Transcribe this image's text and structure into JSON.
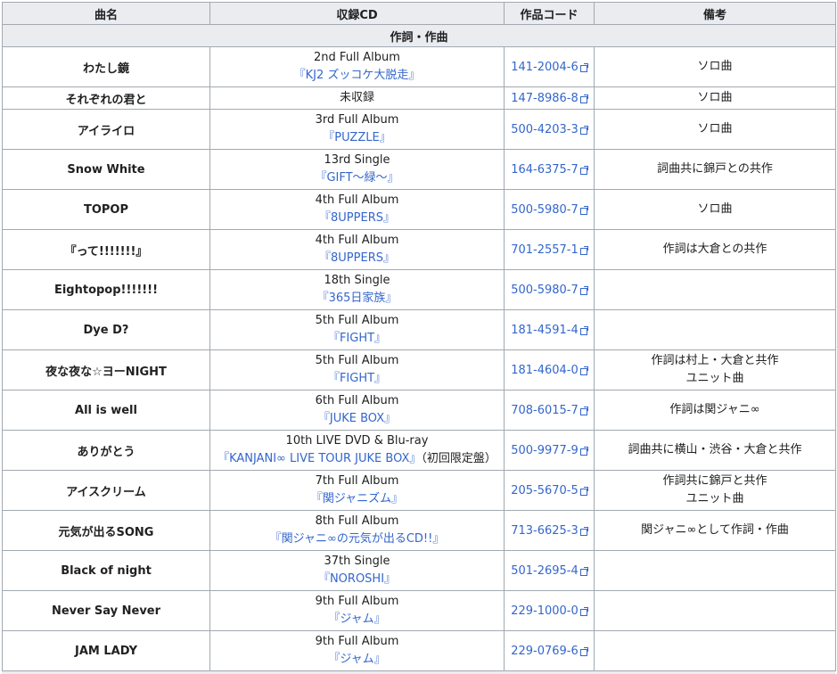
{
  "headers": {
    "song": "曲名",
    "cd": "収録CD",
    "code": "作品コード",
    "notes": "備考"
  },
  "section": "作詞・作曲",
  "rows": [
    {
      "title": "わたし鏡",
      "release": "2nd Full Album",
      "album": "『KJ2 ズッコケ大脱走』",
      "album_extra": "",
      "code": "141-2004-6",
      "notes": [
        "ソロ曲"
      ]
    },
    {
      "title": "それぞれの君と",
      "release": "未収録",
      "album": "",
      "album_extra": "",
      "code": "147-8986-8",
      "notes": [
        "ソロ曲"
      ]
    },
    {
      "title": "アイライロ",
      "release": "3rd Full Album",
      "album": "『PUZZLE』",
      "album_extra": "",
      "code": "500-4203-3",
      "notes": [
        "ソロ曲"
      ]
    },
    {
      "title": "Snow White",
      "release": "13rd Single",
      "album": "『GIFT～緑～』",
      "album_extra": "",
      "code": "164-6375-7",
      "notes": [
        "詞曲共に錦戸との共作"
      ]
    },
    {
      "title": "TOPOP",
      "release": "4th Full Album",
      "album": "『8UPPERS』",
      "album_extra": "",
      "code": "500-5980-7",
      "notes": [
        "ソロ曲"
      ]
    },
    {
      "title": "『って!!!!!!!』",
      "release": "4th Full Album",
      "album": "『8UPPERS』",
      "album_extra": "",
      "code": "701-2557-1",
      "notes": [
        "作詞は大倉との共作"
      ]
    },
    {
      "title": "Eightopop!!!!!!!",
      "release": "18th Single",
      "album": "『365日家族』",
      "album_extra": "",
      "code": "500-5980-7",
      "notes": []
    },
    {
      "title": "Dye D?",
      "release": "5th Full Album",
      "album": "『FIGHT』",
      "album_extra": "",
      "code": "181-4591-4",
      "notes": []
    },
    {
      "title": "夜な夜な☆ヨーNIGHT",
      "release": "5th Full Album",
      "album": "『FIGHT』",
      "album_extra": "",
      "code": "181-4604-0",
      "notes": [
        "作詞は村上・大倉と共作",
        "ユニット曲"
      ]
    },
    {
      "title": "All is well",
      "release": "6th Full Album",
      "album": "『JUKE BOX』",
      "album_extra": "",
      "code": "708-6015-7",
      "notes": [
        "作詞は関ジャニ∞"
      ]
    },
    {
      "title": "ありがとう",
      "release": "10th LIVE DVD & Blu-ray",
      "album": "『KANJANI∞ LIVE TOUR JUKE BOX』",
      "album_extra": "（初回限定盤）",
      "code": "500-9977-9",
      "notes": [
        "詞曲共に横山・渋谷・大倉と共作"
      ]
    },
    {
      "title": "アイスクリーム",
      "release": "7th Full Album",
      "album": "『関ジャニズム』",
      "album_extra": "",
      "code": "205-5670-5",
      "notes": [
        "作詞共に錦戸と共作",
        "ユニット曲"
      ]
    },
    {
      "title": "元気が出るSONG",
      "release": "8th Full Album",
      "album": "『関ジャニ∞の元気が出るCD!!』",
      "album_extra": "",
      "code": "713-6625-3",
      "notes": [
        "関ジャニ∞として作詞・作曲"
      ]
    },
    {
      "title": "Black of night",
      "release": "37th Single",
      "album": "『NOROSHI』",
      "album_extra": "",
      "code": "501-2695-4",
      "notes": []
    },
    {
      "title": "Never Say Never",
      "release": "9th Full Album",
      "album": "『ジャム』",
      "album_extra": "",
      "code": "229-1000-0",
      "notes": []
    },
    {
      "title": "JAM LADY",
      "release": "9th Full Album",
      "album": "『ジャム』",
      "album_extra": "",
      "code": "229-0769-6",
      "notes": []
    }
  ],
  "colors": {
    "header_bg": "#eaecf0",
    "border": "#a2a9b1",
    "link": "#3366cc",
    "text": "#202122"
  }
}
